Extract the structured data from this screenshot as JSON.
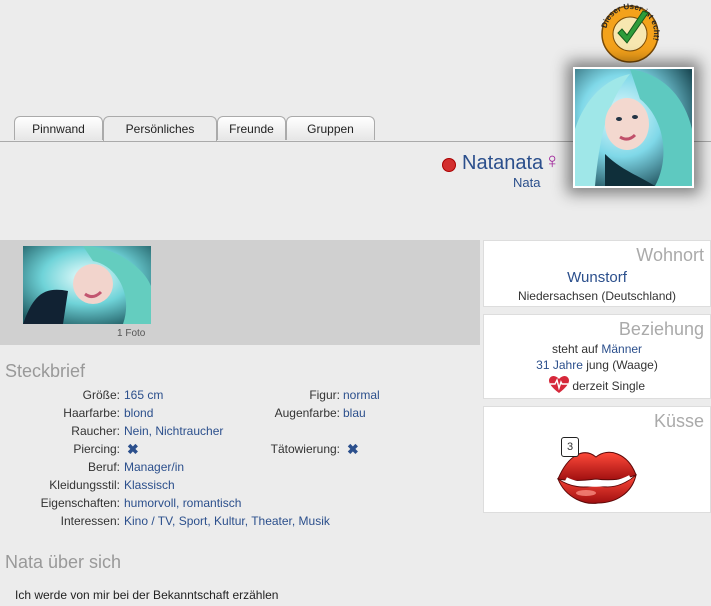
{
  "tabs": [
    "Pinnwand",
    "Persönliches",
    "Freunde",
    "Gruppen"
  ],
  "badge": {
    "text": "Dieser User ist echt!"
  },
  "profile": {
    "username": "Natanata",
    "gender_symbol": "♀",
    "real_name": "Nata",
    "status_color": "#d32f2f"
  },
  "photos": {
    "count_label": "1 Foto"
  },
  "wohnort": {
    "title": "Wohnort",
    "city": "Wunstorf",
    "region": "Niedersachsen (Deutschland)"
  },
  "beziehung": {
    "title": "Beziehung",
    "steht_auf_prefix": "steht auf",
    "steht_auf_value": "Männer",
    "age_value": "31 Jahre",
    "age_suffix": "jung (Waage)",
    "status": "derzeit Single"
  },
  "kuesse": {
    "title": "Küsse",
    "count": "3"
  },
  "steckbrief": {
    "title": "Steckbrief",
    "left": [
      {
        "label": "Größe:",
        "value": "165 cm"
      },
      {
        "label": "Haarfarbe:",
        "value": "blond"
      },
      {
        "label": "Raucher:",
        "value": "Nein, Nichtraucher"
      },
      {
        "label": "Piercing:",
        "value": ""
      },
      {
        "label": "Beruf:",
        "value": "Manager/in"
      },
      {
        "label": "Kleidungsstil:",
        "value": "Klassisch"
      },
      {
        "label": "Eigenschaften:",
        "value": "humorvoll, romantisch"
      },
      {
        "label": "Interessen:",
        "value": "Kino / TV, Sport, Kultur, Theater, Musik"
      }
    ],
    "right": [
      {
        "label": "Figur:",
        "value": "normal"
      },
      {
        "label": "Augenfarbe:",
        "value": "blau"
      },
      {
        "label": "Tätowierung:",
        "value": ""
      }
    ]
  },
  "about": {
    "title": "Nata über sich",
    "text": "Ich werde von mir bei der Bekanntschaft erzählen"
  }
}
